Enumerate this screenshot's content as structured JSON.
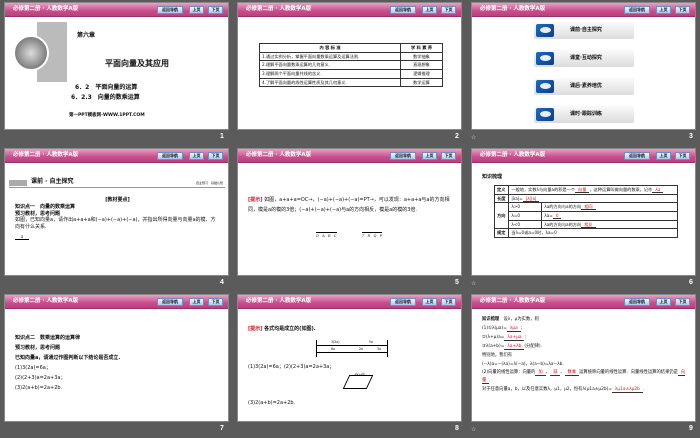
{
  "header": {
    "title": "必修第二册 · 人教数学A版",
    "back": "返回导航",
    "prev": "上页",
    "next": "下页"
  },
  "slides": [
    {
      "num": "1",
      "chapter": "第六章",
      "title": "平面向量及其应用",
      "sub1": "6．2　平面向量的运算",
      "sub2": "6．2.3　向量的数乘运算",
      "site": "第一PPT模板网-WWW.1PPT.COM"
    },
    {
      "num": "2",
      "th1": "内 容 标 准",
      "th2": "学 科 素 养",
      "rows": [
        {
          "c": "1.通过实例分析，掌握平面向量数乘运算及运算法则.",
          "s": "数学抽象"
        },
        {
          "c": "2.理解平面向量数乘运算的几何意义.",
          "s": "直观想象"
        },
        {
          "c": "3.理解两个平面向量共线的含义.",
          "s": "逻辑推理"
        },
        {
          "c": "4.了解平面向量的线性运算性质及其几何意义.",
          "s": "数学运算"
        }
      ]
    },
    {
      "num": "3",
      "items": [
        "课前·自主探究",
        "课堂·互动探究",
        "课后·素养培优",
        "课时·跟踪训练"
      ]
    },
    {
      "num": "4",
      "section": "课前 · 自主探究",
      "aside": "自主预习　基础认知",
      "tag": "[教材要点]",
      "k1": "知识点一　向量的数乘运算",
      "k2": "预习教材，思考问题",
      "q": "如图，已知向量a，请作出a+a+a和(−a)+(−a)+(−a)，并指出所得向量与向量a的模、方向有什么关系.",
      "vec": "a"
    },
    {
      "num": "5",
      "tag": "[提示]",
      "text": "如图，a+a+a=OC→，(−a)+(−a)+(−a)=PT→，可以发现：a+a+a与a的方向相同，模是a的模的3倍；(−a)+(−a)+(−a)与a的方向相反，模是a的模的3倍.",
      "l1": "O　A　B　C",
      "l2": "T　R　Q　P"
    },
    {
      "num": "6",
      "title": "知识梳理",
      "def_h": "定义",
      "def_a": "一般地，实数λ与向量a的积是一个",
      "def_f1": "向量",
      "def_b": "，这种运算叫做向量的数乘，记作",
      "def_f2": "λa",
      "len_h": "长度",
      "len_a": "|λa|=",
      "len_f": "|λ||a|",
      "dir_h": "方向",
      "c1": "λ>0",
      "d1": "λa的方向与a的方向",
      "f1": "相同",
      "c2": "λ=0",
      "d2": "λa=",
      "f2": "0",
      "c3": "λ<0",
      "d3": "λa的方向与a的方向",
      "f3": "相反",
      "rule_h": "规定",
      "rule": "当λ=0或a=0时，λa=0"
    },
    {
      "num": "7",
      "k1": "知识点二　数乘运算的运算律",
      "k2": "预习教材，思考问题",
      "q": "已知向量a，请通过作图判断以下结论是否成立.",
      "e1": "(1)3(2a)=6a；",
      "e2": "(2)(2+3)a=2a+3a；",
      "e3": "(3)2(a+b)=2a+2b."
    },
    {
      "num": "8",
      "tag": "[提示]",
      "text": "各式均是成立的(如图).",
      "e12": "(1)3(2a)=6a；(2)(2+3)a=2a+3a；",
      "e3": "(3)2(a+b)=2a+2b.",
      "d1": "3(2a)",
      "d2": "5a",
      "d3": "6a",
      "d4": "2a",
      "d5": "3a",
      "d6": "2a+2b"
    },
    {
      "num": "9",
      "l0a": "知识梳理",
      "l0b": "设λ，μ为实数，则",
      "l1": "(1)①λ(μa)=",
      "f1": "λμa",
      "l2": "②(λ+μ)a=",
      "f2": "λa+μa",
      "l3": "③λ(a+b)=",
      "f3": "λa+λb",
      "l3b": "(分配律).",
      "l4": "特别地，我们有",
      "l5": "(−λ)a=−(λa)=λ(−a)，λ(a−b)=λa−λb.",
      "l6a": "(2)向量的线性运算：向量的",
      "f4": "加",
      "f5": "减",
      "f6": "数乘",
      "l6b": "运算统称向量的线性运算．向量线性运算的结果仍是",
      "f7": "向量",
      "l7": "对于任意向量a，b，以及任意实数λ，μ1，μ2，恒有λ(μ1a±μ2b)=",
      "f8": "λμ1a±λμ2b"
    }
  ]
}
